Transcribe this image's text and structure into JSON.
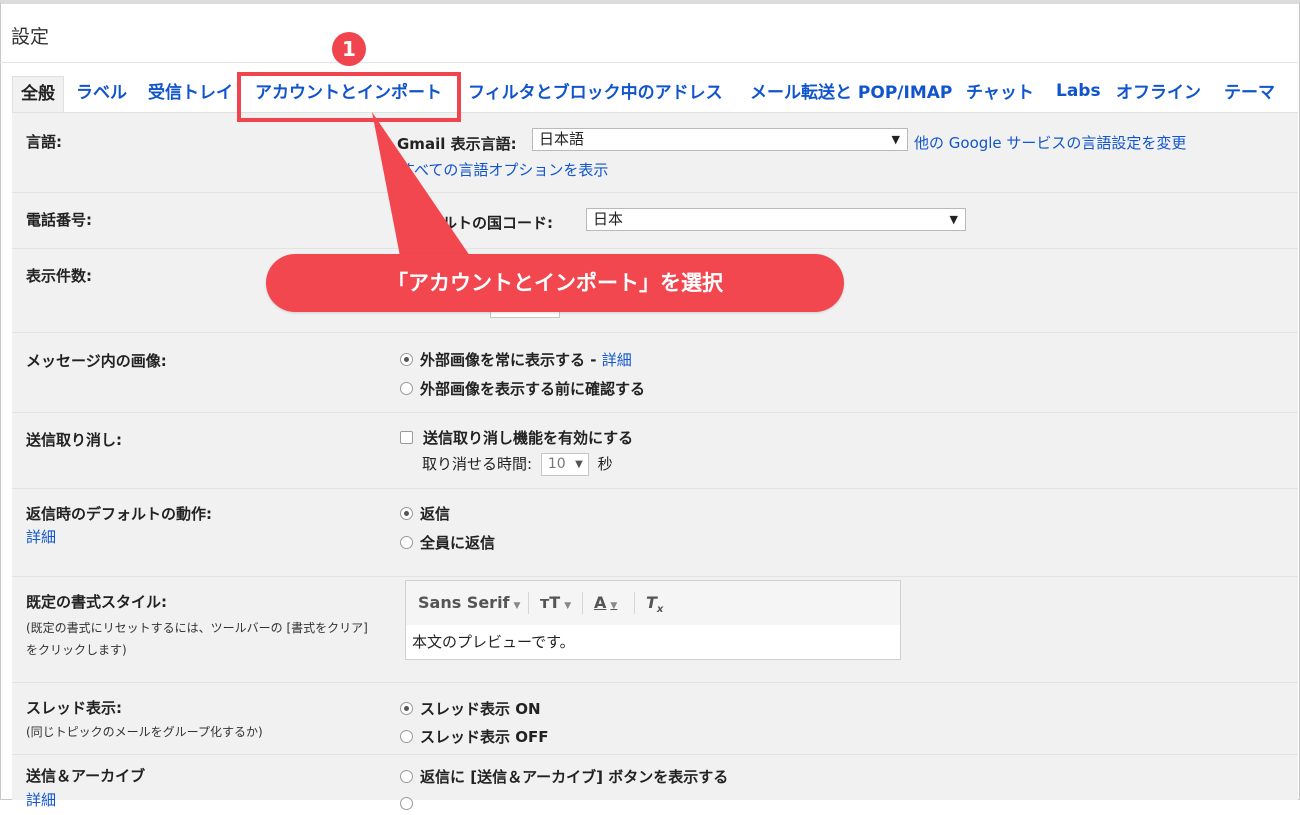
{
  "page": {
    "title": "設定"
  },
  "tabs": [
    {
      "label": "全般",
      "active": true
    },
    {
      "label": "ラベル"
    },
    {
      "label": "受信トレイ"
    },
    {
      "label": "アカウントとインポート"
    },
    {
      "label": "フィルタとブロック中のアドレス"
    },
    {
      "label": "メール転送と POP/IMAP"
    },
    {
      "label": "チャット"
    },
    {
      "label": "Labs"
    },
    {
      "label": "オフライン"
    },
    {
      "label": "テーマ"
    }
  ],
  "settings": {
    "language": {
      "label": "言語:",
      "control_label": "Gmail 表示言語:",
      "value": "日本語",
      "other_services_link": "他の Google サービスの言語設定を変更",
      "all_options_link": "すべての言語オプションを表示"
    },
    "phone": {
      "label": "電話番号:",
      "control_label": "デフォルトの国コード:",
      "value": "日本"
    },
    "page_size": {
      "label": "表示件数:"
    },
    "images": {
      "label": "メッセージ内の画像:",
      "option1": "外部画像を常に表示する",
      "option1_sep": " - ",
      "details_link": "詳細",
      "option2": "外部画像を表示する前に確認する"
    },
    "undo_send": {
      "label": "送信取り消し:",
      "checkbox_label": "送信取り消し機能を有効にする",
      "period_label": "取り消せる時間:",
      "period_value": "10",
      "period_unit": "秒"
    },
    "reply_default": {
      "label": "返信時のデフォルトの動作:",
      "details_link": "詳細",
      "option1": "返信",
      "option2": "全員に返信"
    },
    "text_style": {
      "label": "既定の書式スタイル:",
      "description": "(既定の書式にリセットするには、ツールバーの [書式をクリア] をクリックします)",
      "font": "Sans Serif",
      "preview": "本文のプレビューです。"
    },
    "threading": {
      "label": "スレッド表示:",
      "description": "(同じトピックのメールをグループ化するか)",
      "option1": "スレッド表示 ON",
      "option2": "スレッド表示 OFF"
    },
    "send_archive": {
      "label": "送信＆アーカイブ",
      "details_link": "詳細",
      "option1": "返信に [送信＆アーカイブ] ボタンを表示する"
    }
  },
  "annotation": {
    "step_number": "1",
    "callout_text": "「アカウントとインポート」を選択",
    "color": "#f0454f"
  }
}
